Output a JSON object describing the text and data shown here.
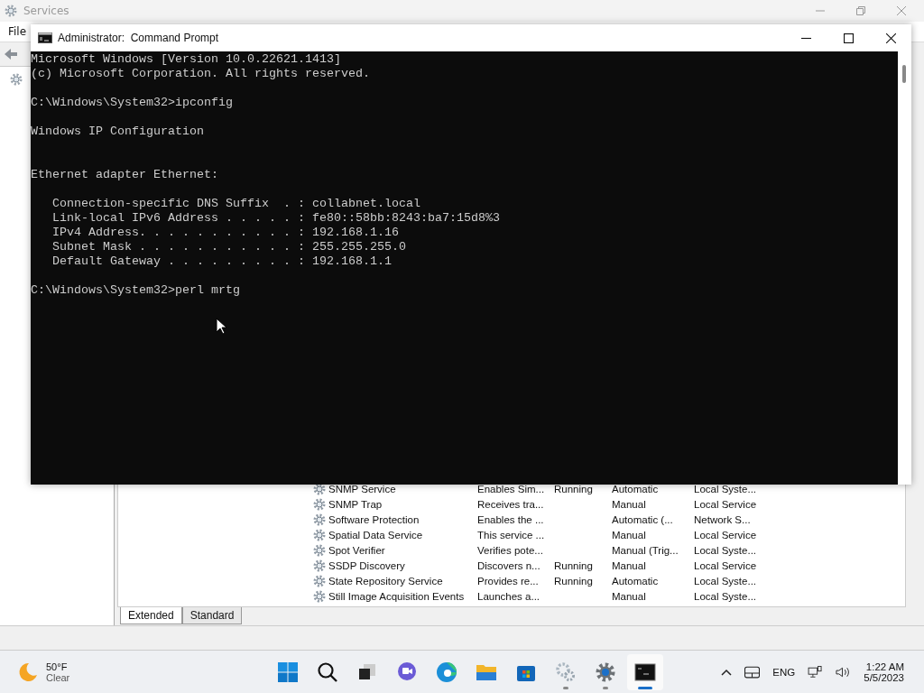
{
  "services_window": {
    "title": "Services",
    "menu": [
      "File"
    ],
    "rows": [
      {
        "name": "SNMP Service",
        "description": "Enables Sim...",
        "status": "Running",
        "startup": "Automatic",
        "log_on_as": "Local Syste..."
      },
      {
        "name": "SNMP Trap",
        "description": "Receives tra...",
        "status": "",
        "startup": "Manual",
        "log_on_as": "Local Service"
      },
      {
        "name": "Software Protection",
        "description": "Enables the ...",
        "status": "",
        "startup": "Automatic (...",
        "log_on_as": "Network S..."
      },
      {
        "name": "Spatial Data Service",
        "description": "This service ...",
        "status": "",
        "startup": "Manual",
        "log_on_as": "Local Service"
      },
      {
        "name": "Spot Verifier",
        "description": "Verifies pote...",
        "status": "",
        "startup": "Manual (Trig...",
        "log_on_as": "Local Syste..."
      },
      {
        "name": "SSDP Discovery",
        "description": "Discovers n...",
        "status": "Running",
        "startup": "Manual",
        "log_on_as": "Local Service"
      },
      {
        "name": "State Repository Service",
        "description": "Provides re...",
        "status": "Running",
        "startup": "Automatic",
        "log_on_as": "Local Syste..."
      },
      {
        "name": "Still Image Acquisition Events",
        "description": "Launches a...",
        "status": "",
        "startup": "Manual",
        "log_on_as": "Local Syste..."
      }
    ],
    "tabs": [
      {
        "label": "Extended",
        "selected": true
      },
      {
        "label": "Standard",
        "selected": false
      }
    ]
  },
  "command_prompt": {
    "title": "Administrator:  Command Prompt",
    "output": [
      {
        "kind": "output",
        "text": "Microsoft Windows [Version 10.0.22621.1413]\n(c) Microsoft Corporation. All rights reserved."
      },
      {
        "kind": "output",
        "text": "C:\\Windows\\System32>ipconfig"
      },
      {
        "kind": "output",
        "text": "Windows IP Configuration"
      },
      {
        "kind": "section",
        "text": "Ethernet adapter Ethernet:"
      },
      {
        "kind": "output",
        "text": "   Connection-specific DNS Suffix  . : collabnet.local\n   Link-local IPv6 Address . . . . . : fe80::58bb:8243:ba7:15d8%3\n   IPv4 Address. . . . . . . . . . . : 192.168.1.16\n   Subnet Mask . . . . . . . . . . . : 255.255.255.0\n   Default Gateway . . . . . . . . . : 192.168.1.1"
      },
      {
        "kind": "output",
        "text": "C:\\Windows\\System32>perl mrtg"
      }
    ]
  },
  "taskbar": {
    "weather": {
      "temperature": "50°F",
      "condition": "Clear"
    },
    "apps": [
      {
        "kind": "start",
        "open": false,
        "selected": false
      },
      {
        "kind": "search",
        "open": false,
        "selected": false
      },
      {
        "kind": "taskview",
        "open": false,
        "selected": false
      },
      {
        "kind": "chat",
        "open": false,
        "selected": false
      },
      {
        "kind": "edge",
        "open": false,
        "selected": false
      },
      {
        "kind": "explorer",
        "open": false,
        "selected": false
      },
      {
        "kind": "store",
        "open": false,
        "selected": false
      },
      {
        "kind": "services",
        "open": true,
        "selected": false
      },
      {
        "kind": "settings",
        "open": true,
        "selected": false
      },
      {
        "kind": "terminal",
        "open": true,
        "selected": true
      }
    ],
    "language": "ENG",
    "time": "1:22 AM",
    "date": "5/5/2023"
  }
}
